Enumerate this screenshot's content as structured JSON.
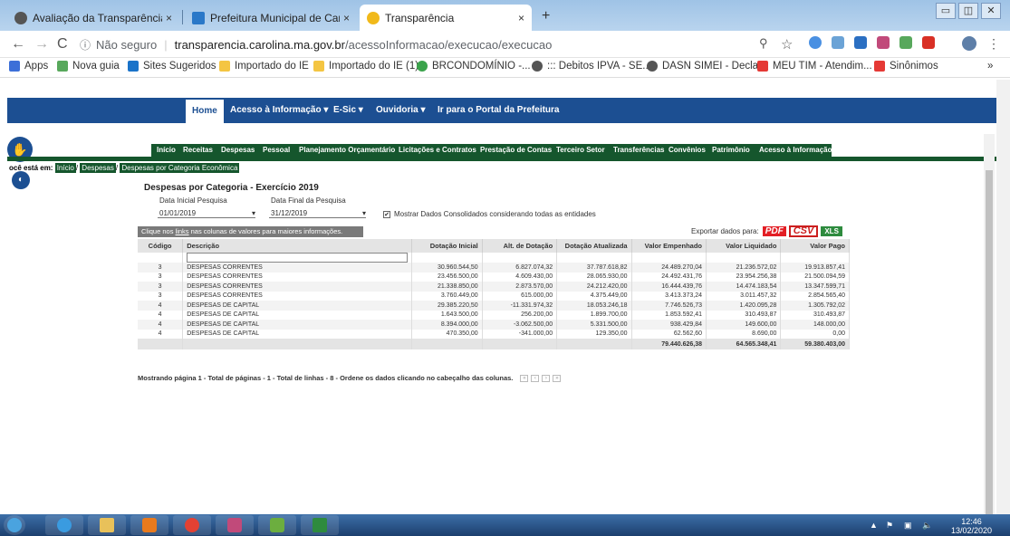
{
  "browser": {
    "tabs": [
      {
        "title": "Avaliação da Transparência dos",
        "close": "×"
      },
      {
        "title": "Prefeitura Municipal de Carolina",
        "close": "×"
      },
      {
        "title": "Transparência",
        "close": "×"
      }
    ],
    "new_tab": "+",
    "window_controls": [
      "▭",
      "◫",
      "✕"
    ],
    "url": {
      "security": "Não seguro",
      "host": "transparencia.carolina.ma.gov.br",
      "path": "/acessoInformacao/execucao/execucao"
    },
    "bookmarks": [
      "Apps",
      "Nova guia",
      "Sites Sugeridos",
      "Importado do IE",
      "Importado do IE (1)",
      "BRCONDOMÍNIO -...",
      "::: Debitos IPVA - SE...",
      "DASN SIMEI - Decla...",
      "MEU TIM - Atendim...",
      "Sinônimos",
      "»"
    ]
  },
  "site": {
    "topnav": [
      "Home",
      "Acesso à Informação ▾",
      "E-Sic ▾",
      "Ouvidoria ▾",
      "Ir para o Portal da Prefeitura"
    ],
    "menu": [
      "Início",
      "Receitas",
      "Despesas",
      "Pessoal",
      "Planejamento Orçamentário",
      "Licitações e Contratos",
      "Prestação de Contas",
      "Terceiro Setor",
      "Transferências",
      "Convênios",
      "Patrimônio",
      "Acesso à Informação"
    ],
    "breadcrumb": {
      "prefix": "ocê está em:",
      "items": [
        "Início",
        "Despesas",
        "Despesas por Categoria Econômica"
      ],
      "sep": "/"
    }
  },
  "page": {
    "title": "Despesas por Categoria - Exercício 2019",
    "date_start_label": "Data Inicial Pesquisa",
    "date_start": "01/01/2019",
    "date_end_label": "Data Final da Pesquisa",
    "date_end": "31/12/2019",
    "consolidated_label": "Mostrar Dados Consolidados considerando todas as entidades",
    "hint_pre": "Clique nos ",
    "hint_link": "links",
    "hint_post": " nas colunas de valores para maiores informações.",
    "export_label": "Exportar dados para:",
    "export_pdf": "PDF",
    "export_csv": "CSV",
    "export_xls": "XLS",
    "columns": [
      "Código",
      "Descrição",
      "Dotação Inicial",
      "Alt. de Dotação",
      "Dotação Atualizada",
      "Valor Empenhado",
      "Valor Liquidado",
      "Valor Pago"
    ],
    "rows": [
      [
        "3",
        "DESPESAS CORRENTES",
        "30.960.544,50",
        "6.827.074,32",
        "37.787.618,82",
        "24.489.270,04",
        "21.236.572,02",
        "19.913.857,41"
      ],
      [
        "3",
        "DESPESAS CORRENTES",
        "23.456.500,00",
        "4.609.430,00",
        "28.065.930,00",
        "24.492.431,76",
        "23.954.256,38",
        "21.500.094,59"
      ],
      [
        "3",
        "DESPESAS CORRENTES",
        "21.338.850,00",
        "2.873.570,00",
        "24.212.420,00",
        "16.444.439,76",
        "14.474.183,54",
        "13.347.599,71"
      ],
      [
        "3",
        "DESPESAS CORRENTES",
        "3.760.449,00",
        "615.000,00",
        "4.375.449,00",
        "3.413.373,24",
        "3.011.457,32",
        "2.854.565,40"
      ],
      [
        "4",
        "DESPESAS DE CAPITAL",
        "29.385.220,50",
        "-11.331.974,32",
        "18.053.246,18",
        "7.746.526,73",
        "1.420.095,28",
        "1.305.792,02"
      ],
      [
        "4",
        "DESPESAS DE CAPITAL",
        "1.643.500,00",
        "256.200,00",
        "1.899.700,00",
        "1.853.592,41",
        "310.493,87",
        "310.493,87"
      ],
      [
        "4",
        "DESPESAS DE CAPITAL",
        "8.394.000,00",
        "-3.062.500,00",
        "5.331.500,00",
        "938.429,84",
        "149.600,00",
        "148.000,00"
      ],
      [
        "4",
        "DESPESAS DE CAPITAL",
        "470.350,00",
        "-341.000,00",
        "129.350,00",
        "62.562,60",
        "8.690,00",
        "0,00"
      ]
    ],
    "totals": {
      "empenhado": "79.440.626,38",
      "liquidado": "64.565.348,41",
      "pago": "59.380.403,00"
    },
    "pager_text": "Mostrando página 1 - Total de páginas - 1 - Total de linhas - 8 - Ordene os dados clicando no cabeçalho das colunas."
  },
  "taskbar": {
    "time": "12:46",
    "date": "13/02/2020"
  }
}
